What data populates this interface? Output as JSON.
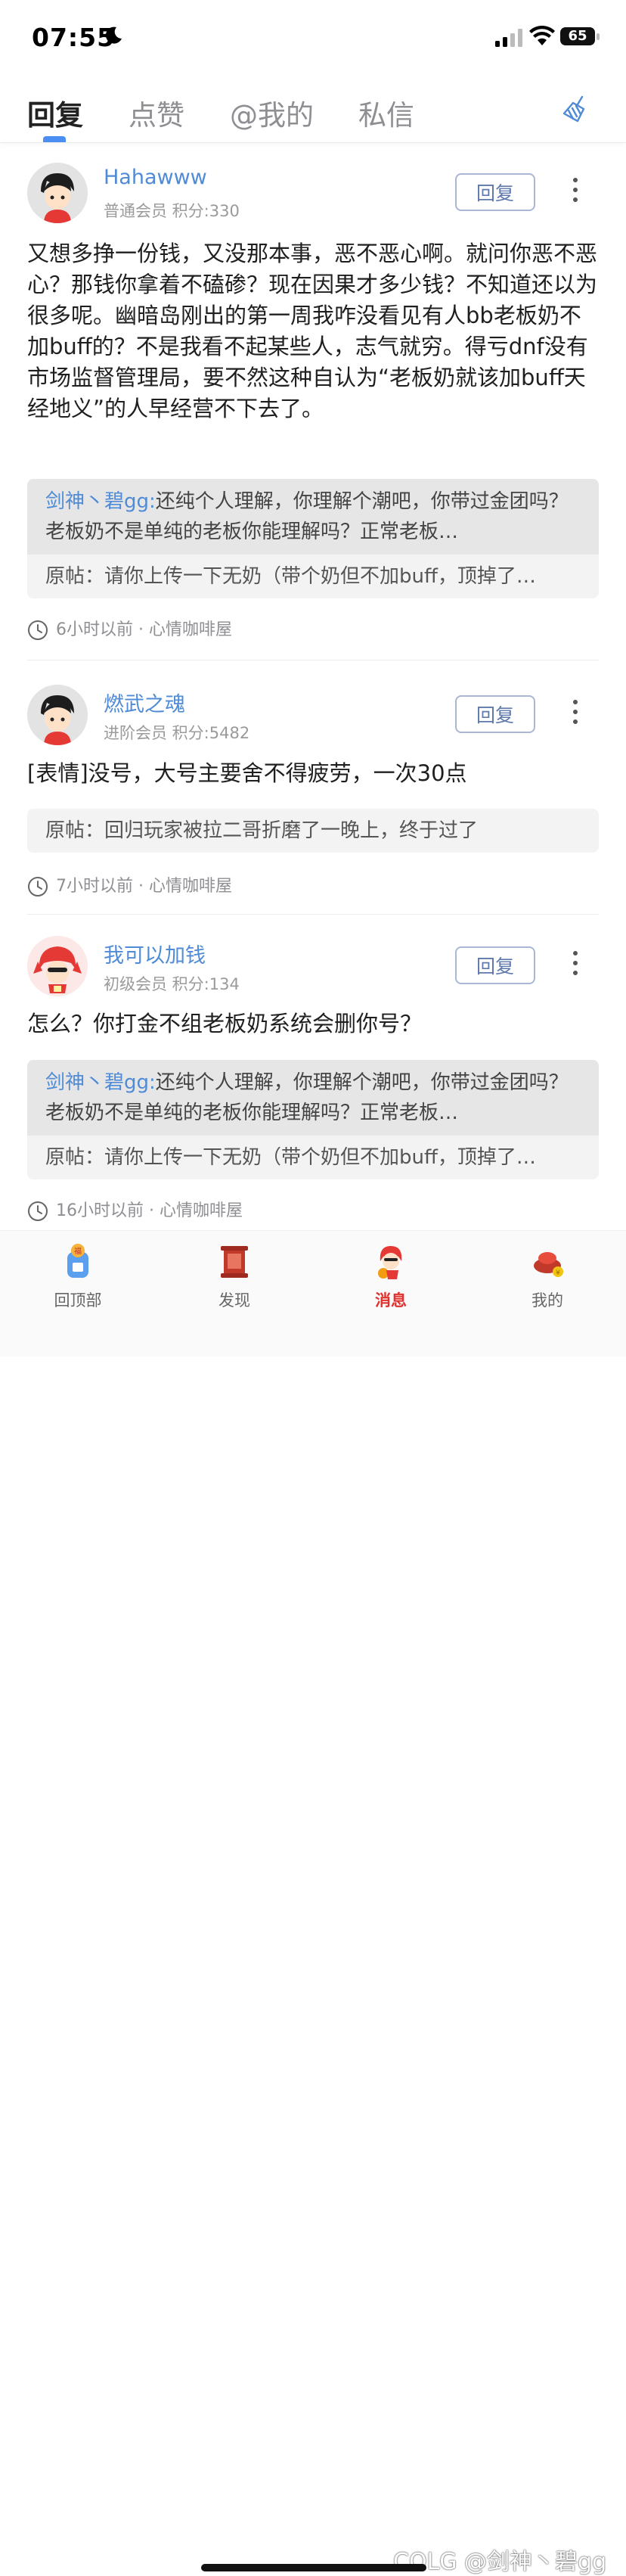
{
  "status": {
    "time": "07:55",
    "battery": "65"
  },
  "tabs": [
    {
      "label": "回复"
    },
    {
      "label": "点赞"
    },
    {
      "label": "@我的"
    },
    {
      "label": "私信"
    }
  ],
  "posts": [
    {
      "username": "Hahawww",
      "meta": "普通会员 积分:330",
      "reply_label": "回复",
      "content": "又想多挣一份钱，又没那本事，恶不恶心啊。就问你恶不恶心？那钱你拿着不磕碜？现在因果才多少钱？不知道还以为很多呢。幽暗岛刚出的第一周我咋没看见有人bb老板奶不加buff的？不是我看不起某些人，志气就穷。得亏dnf没有市场监督管理局，要不然这种自认为“老板奶就该加buff天经地义”的人早经营不下去了。",
      "quote_who": "剑神丶碧gg:",
      "quote_text": "还纯个人理解，你理解个潮吧，你带过金团吗？老板奶不是单纯的老板你能理解吗？正常老板…",
      "original": "原帖：请你上传一下无奶（带个奶但不加buff，顶掉了…",
      "time": "6小时以前 · 心情咖啡屋"
    },
    {
      "username": "燃武之魂",
      "meta": "进阶会员 积分:5482",
      "reply_label": "回复",
      "content": "[表情]没号，大号主要舍不得疲劳，一次30点",
      "original": "原帖：回归玩家被拉二哥折磨了一晚上，终于过了",
      "time": "7小时以前 · 心情咖啡屋"
    },
    {
      "username": "我可以加钱",
      "meta": "初级会员 积分:134",
      "reply_label": "回复",
      "content": "怎么？你打金不组老板奶系统会删你号？",
      "quote_who": "剑神丶碧gg:",
      "quote_text": "还纯个人理解，你理解个潮吧，你带过金团吗？老板奶不是单纯的老板你能理解吗？正常老板…",
      "original": "原帖：请你上传一下无奶（带个奶但不加buff，顶掉了…",
      "time": "16小时以前 · 心情咖啡屋"
    }
  ],
  "nav": [
    {
      "label": "回顶部",
      "icon": "back-to-top-icon"
    },
    {
      "label": "发现",
      "icon": "discover-icon"
    },
    {
      "label": "消息",
      "icon": "message-icon"
    },
    {
      "label": "我的",
      "icon": "profile-icon"
    }
  ],
  "watermark": "COLG @剑神丶碧gg",
  "colors": {
    "accent": "#4f8bd6",
    "active_nav": "#e0312e",
    "tab_indicator": "#4a8ef2"
  }
}
